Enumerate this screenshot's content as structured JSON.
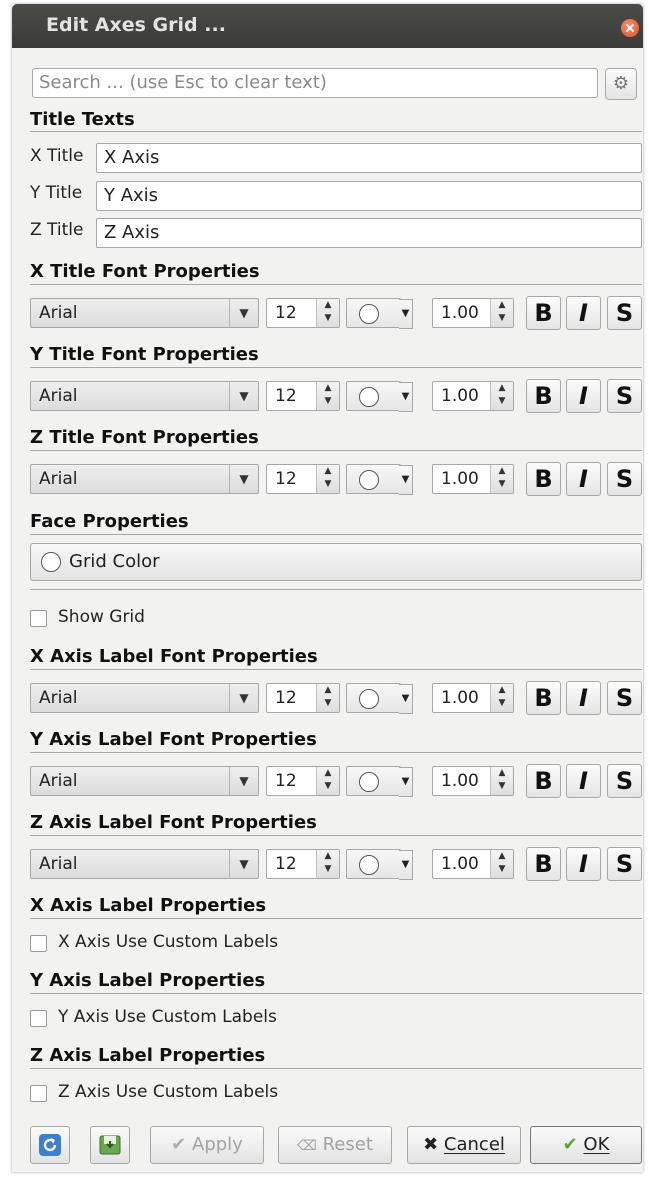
{
  "window": {
    "title": "Edit Axes Grid ..."
  },
  "search": {
    "placeholder": "Search ... (use Esc to clear text)"
  },
  "sections": {
    "title_texts": "Title Texts",
    "x_title_font": "X Title Font Properties",
    "y_title_font": "Y Title Font Properties",
    "z_title_font": "Z Title Font Properties",
    "face": "Face Properties",
    "x_label_font": "X Axis Label Font Properties",
    "y_label_font": "Y Axis Label Font Properties",
    "z_label_font": "Z Axis Label Font Properties",
    "x_label_props": "X Axis Label Properties",
    "y_label_props": "Y Axis Label Properties",
    "z_label_props": "Z Axis Label Properties"
  },
  "titles": {
    "x": {
      "label": "X Title",
      "value": "X Axis"
    },
    "y": {
      "label": "Y Title",
      "value": "Y Axis"
    },
    "z": {
      "label": "Z Title",
      "value": "Z Axis"
    }
  },
  "font_row": {
    "family": "Arial",
    "size": "12",
    "opacity": "1.00",
    "bold": "B",
    "italic": "I",
    "shadow": "S"
  },
  "face": {
    "grid_color": "Grid Color"
  },
  "show_grid": {
    "label": "Show Grid",
    "checked": false
  },
  "custom_labels": {
    "x": "X Axis Use Custom Labels",
    "y": "Y Axis Use Custom Labels",
    "z": "Z Axis Use Custom Labels"
  },
  "buttons": {
    "apply": "Apply",
    "reset": "Reset",
    "cancel": "Cancel",
    "ok": "OK"
  },
  "icons": [
    "gear-icon",
    "close-icon",
    "refresh-icon",
    "save-defaults-icon",
    "check-icon",
    "x-icon"
  ]
}
